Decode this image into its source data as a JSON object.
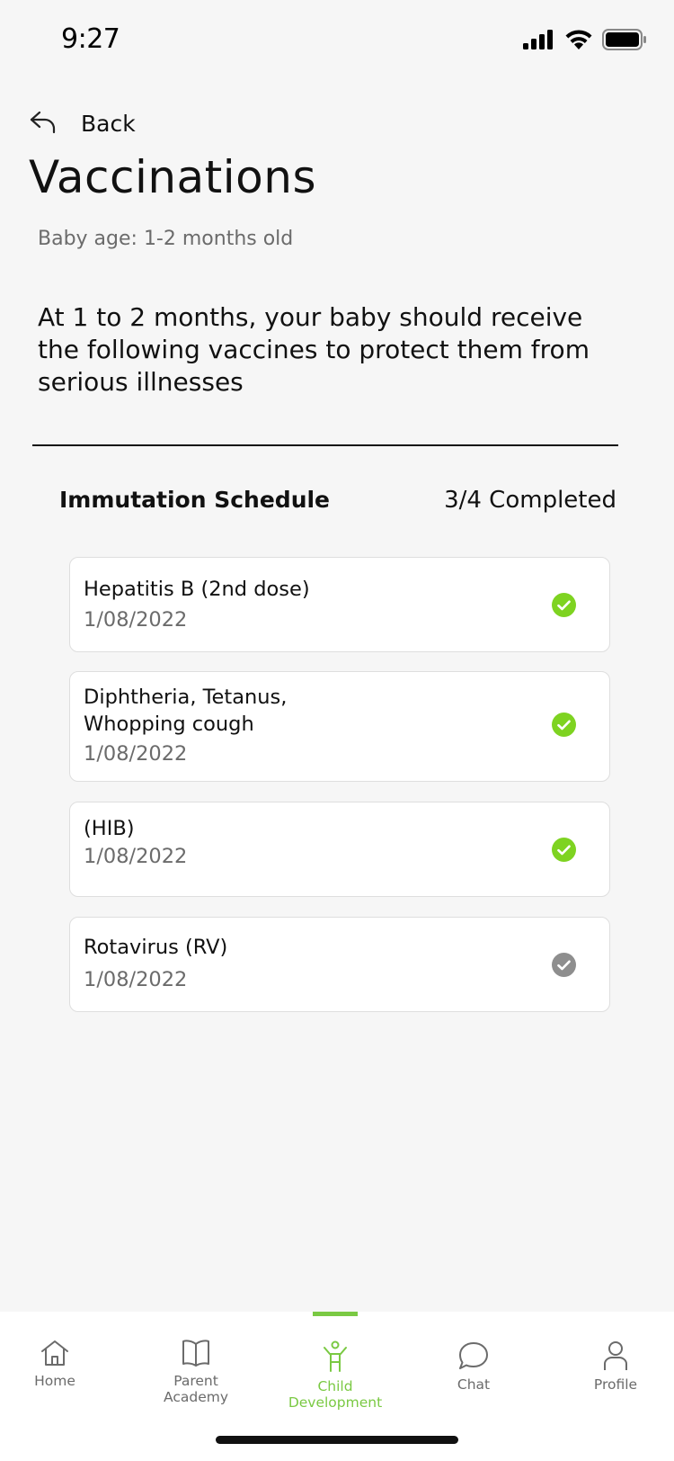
{
  "status": {
    "time": "9:27"
  },
  "nav": {
    "back_label": "Back"
  },
  "page": {
    "title": "Vaccinations",
    "age": "Baby age: 1-2 months old",
    "intro": "At 1 to 2 months, your baby should receive the following vaccines to protect them from serious illnesses"
  },
  "schedule": {
    "title": "Immutation Schedule",
    "progress": "3/4 Completed",
    "items": [
      {
        "name": "Hepatitis B (2nd dose)",
        "date": "1/08/2022",
        "completed": true
      },
      {
        "name": "Diphtheria, Tetanus,\nWhopping cough",
        "date": "1/08/2022",
        "completed": true
      },
      {
        "name": "(HIB)",
        "date": "1/08/2022",
        "completed": true
      },
      {
        "name": "Rotavirus (RV)",
        "date": "1/08/2022",
        "completed": false
      }
    ]
  },
  "tabbar": {
    "active_color": "#7ac943",
    "items": [
      {
        "label": "Home",
        "icon": "home-icon"
      },
      {
        "label": "Parent\nAcademy",
        "icon": "book-icon"
      },
      {
        "label": "Child\nDevelopment",
        "icon": "child-icon"
      },
      {
        "label": "Chat",
        "icon": "chat-icon"
      },
      {
        "label": "Profile",
        "icon": "profile-icon"
      }
    ]
  },
  "colors": {
    "check_done": "#7ed321",
    "check_pending": "#8e8e8e"
  }
}
